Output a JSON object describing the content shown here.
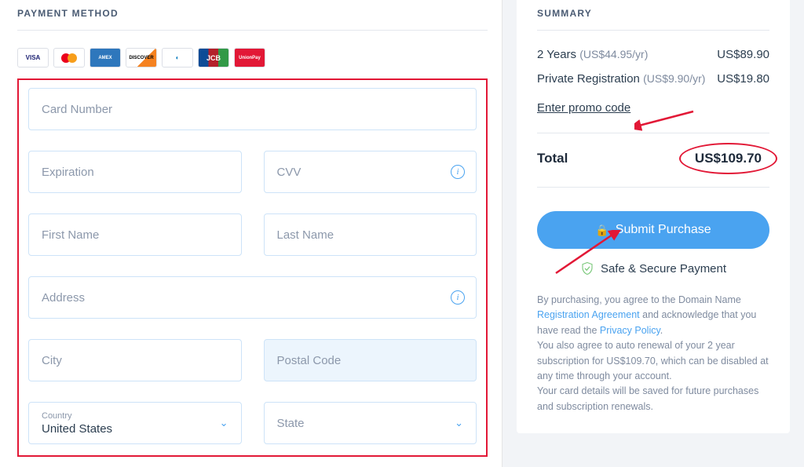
{
  "left": {
    "title": "PAYMENT METHOD",
    "cards": [
      "visa",
      "mc",
      "amex",
      "disc",
      "diners",
      "jcb",
      "up"
    ],
    "fields": {
      "card_number": "Card Number",
      "expiration": "Expiration",
      "cvv": "CVV",
      "first_name": "First Name",
      "last_name": "Last Name",
      "address": "Address",
      "city": "City",
      "postal": "Postal Code",
      "country_label": "Country",
      "country_value": "United States",
      "state_label": "State"
    }
  },
  "right": {
    "title": "SUMMARY",
    "line1_label": "2 Years",
    "line1_sub": "(US$44.95/yr)",
    "line1_val": "US$89.90",
    "line2_label": "Private Registration",
    "line2_sub": "(US$9.90/yr)",
    "line2_val": "US$19.80",
    "promo": "Enter promo code",
    "total_label": "Total",
    "total_val": "US$109.70",
    "submit": "Submit Purchase",
    "secure": "Safe & Secure Payment",
    "fine1a": "By purchasing, you agree to the Domain Name ",
    "fine1b": "Registration Agreement",
    "fine1c": " and acknowledge that you have read the ",
    "fine1d": "Privacy Policy",
    "fine1e": ".",
    "fine2": "You also agree to auto renewal of your 2 year subscription for US$109.70, which can be disabled at any time through your account.",
    "fine3": "Your card details will be saved for future purchases and subscription renewals."
  }
}
